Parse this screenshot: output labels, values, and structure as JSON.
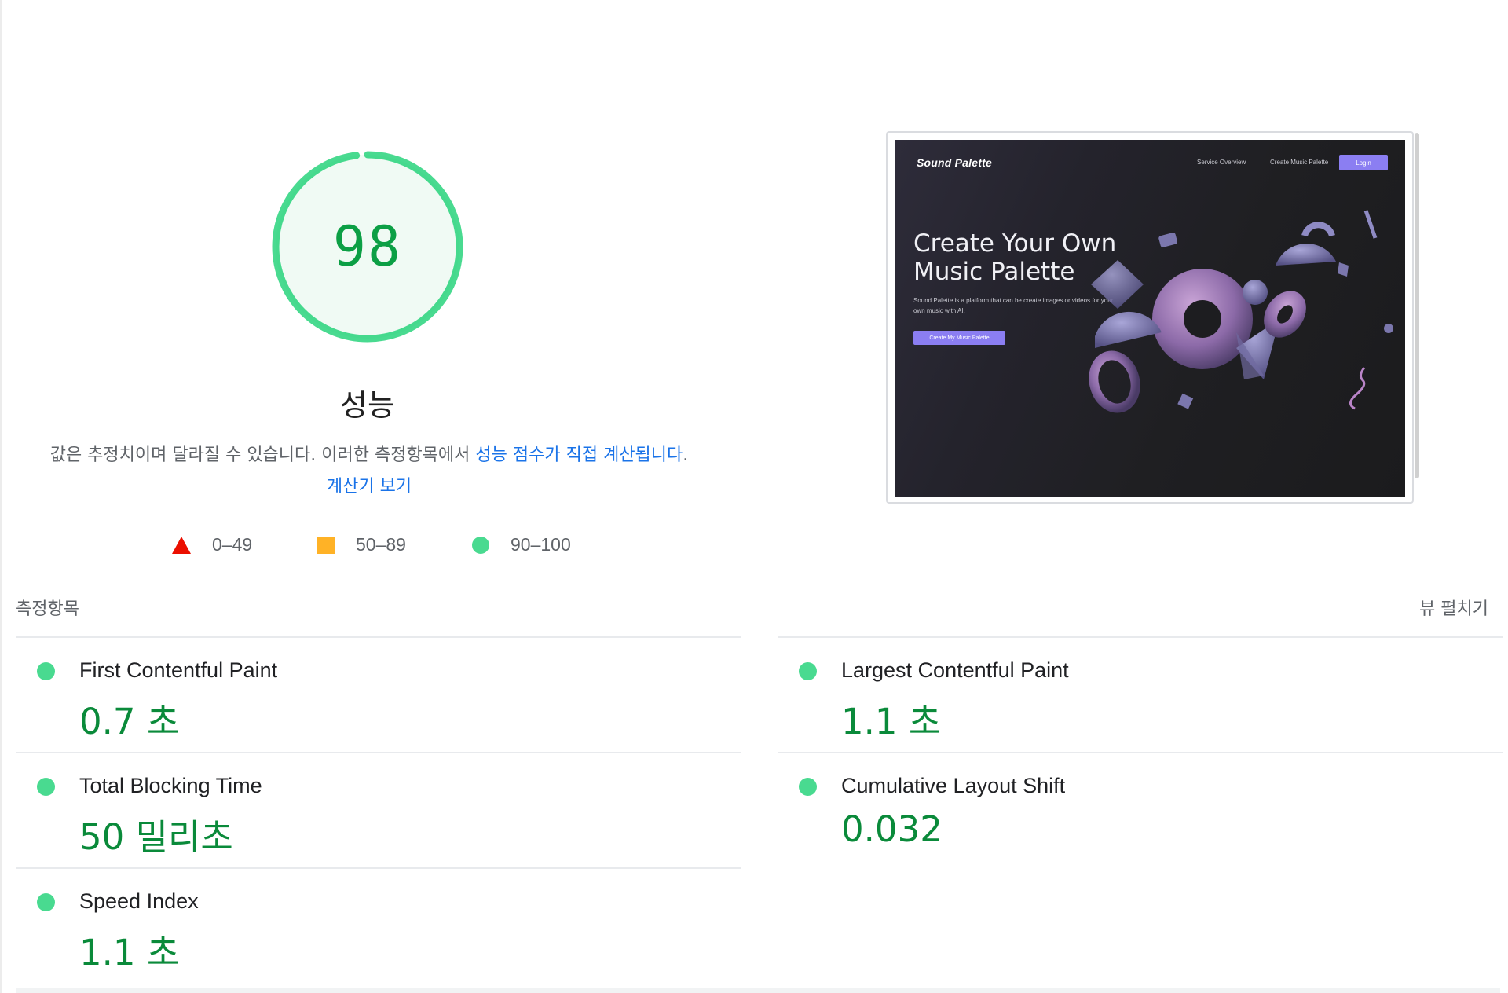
{
  "gauge": {
    "score": "98",
    "fraction": 0.98,
    "color": "#0cce6b"
  },
  "category": {
    "title": "성능",
    "description_prefix": "값은 추정치이며 달라질 수 있습니다. 이러한 측정항목에서 ",
    "description_link1": "성능 점수가 직접 계산됩니다",
    "description_mid": ". ",
    "description_link2": "계산기 보기"
  },
  "legend": [
    {
      "icon": "fail-triangle-icon",
      "label": "0–49",
      "color": "#eb0f00"
    },
    {
      "icon": "average-square-icon",
      "label": "50–89",
      "color": "#ffa400"
    },
    {
      "icon": "pass-circle-icon",
      "label": "90–100",
      "color": "#0cce6b"
    }
  ],
  "screenshot": {
    "logo": "Sound Palette",
    "nav": [
      "Service Overview",
      "Create Music Palette"
    ],
    "login": "Login",
    "headline_line1": "Create Your Own",
    "headline_line2": "Music Palette",
    "description": "Sound Palette is a platform that can be create images or videos for your own music with AI.",
    "cta": "Create My Music Palette"
  },
  "metrics": {
    "header": "측정항목",
    "expand": "뷰 펼치기",
    "items": [
      {
        "name": "First Contentful Paint",
        "value": "0.7 초"
      },
      {
        "name": "Largest Contentful Paint",
        "value": "1.1 초"
      },
      {
        "name": "Total Blocking Time",
        "value": "50 밀리초"
      },
      {
        "name": "Cumulative Layout Shift",
        "value": "0.032"
      },
      {
        "name": "Speed Index",
        "value": "1.1 초"
      }
    ]
  }
}
